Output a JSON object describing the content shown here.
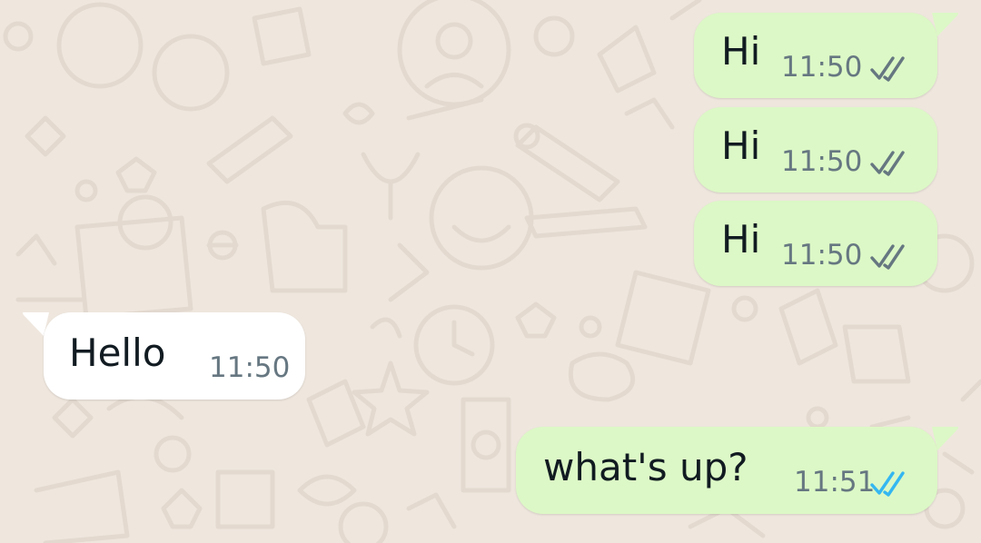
{
  "colors": {
    "outgoing_bubble": "#dcf8c6",
    "incoming_bubble": "#ffffff",
    "chat_background": "#efe7de",
    "read_ticks": "#34b7f1",
    "sent_ticks": "#667781"
  },
  "messages": [
    {
      "direction": "outgoing",
      "text": "Hi",
      "time": "11:50",
      "status_icon": "double-check-grey-icon"
    },
    {
      "direction": "outgoing",
      "text": "Hi",
      "time": "11:50",
      "status_icon": "double-check-grey-icon"
    },
    {
      "direction": "outgoing",
      "text": "Hi",
      "time": "11:50",
      "status_icon": "double-check-grey-icon"
    },
    {
      "direction": "incoming",
      "text": "Hello",
      "time": "11:50"
    },
    {
      "direction": "outgoing",
      "text": "what's up?",
      "time": "11:51",
      "status_icon": "double-check-blue-icon"
    }
  ]
}
